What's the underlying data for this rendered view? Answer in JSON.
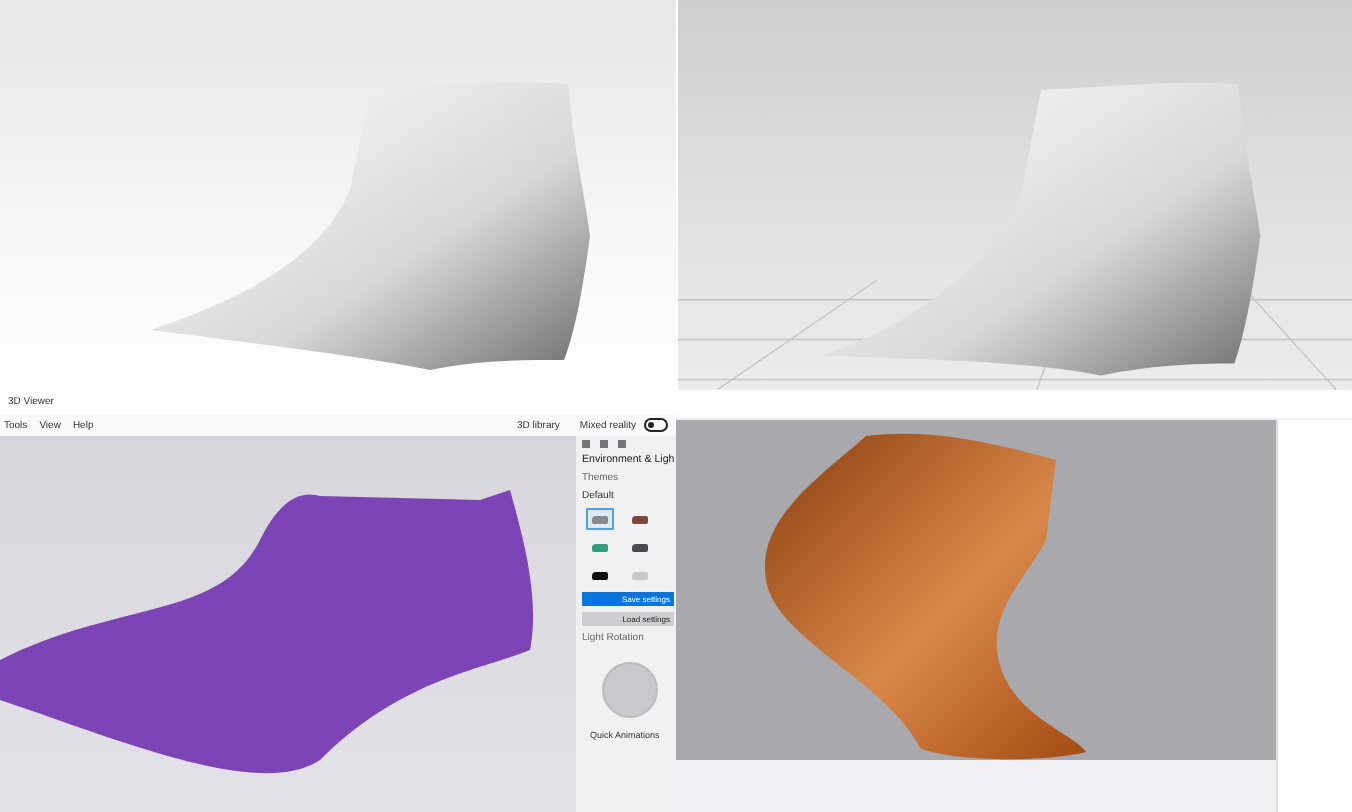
{
  "viewer_window": {
    "title": "3D Viewer",
    "menu": [
      "Tools",
      "View",
      "Help"
    ],
    "library_button": "3D library",
    "mixed_reality": {
      "label": "Mixed reality",
      "on": false
    },
    "panel": {
      "heading": "Environment & Ligh",
      "themes_label": "Themes",
      "default_label": "Default",
      "themes": [
        {
          "selected": true,
          "color": "#8a8a8a"
        },
        {
          "selected": false,
          "color": "#7a4a36"
        },
        {
          "selected": false,
          "color": "#2f9e7e"
        },
        {
          "selected": false,
          "color": "#4a4a4a"
        },
        {
          "selected": false,
          "color": "#111111"
        },
        {
          "selected": false,
          "color": "#c8c8c8"
        }
      ],
      "save_button": "Save settings",
      "load_button": "Load settings",
      "light_rotation_label": "Light Rotation",
      "quick_animations": "Quick Animations"
    }
  }
}
